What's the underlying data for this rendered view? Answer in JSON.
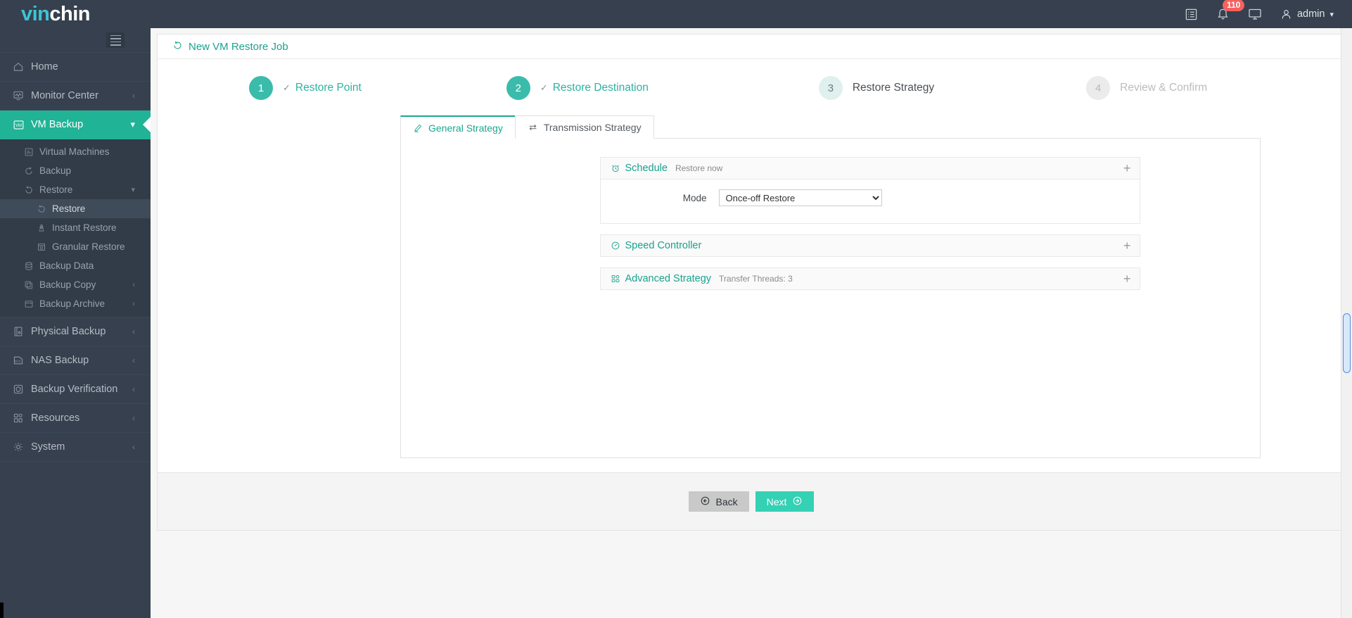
{
  "brand": {
    "part1": "vin",
    "part2": "chin"
  },
  "topbar": {
    "tasks_icon": "list-icon",
    "notifications_icon": "bell-icon",
    "notification_count": "110",
    "display_icon": "monitor-icon",
    "user_icon": "user-icon",
    "user_name": "admin",
    "user_chevron": "chevron-down-icon"
  },
  "sidebar": {
    "toggle": "hamburger-icon",
    "items": [
      {
        "label": "Home",
        "icon": "home-icon",
        "chevron": ""
      },
      {
        "label": "Monitor Center",
        "icon": "monitor-chart-icon",
        "chevron": "‹"
      },
      {
        "label": "VM Backup",
        "icon": "vm-icon",
        "chevron": "⌄",
        "active": true
      }
    ],
    "vm_backup_children": [
      {
        "label": "Virtual Machines",
        "icon": "grid-chart-icon",
        "chevron": ""
      },
      {
        "label": "Backup",
        "icon": "refresh-icon",
        "chevron": ""
      },
      {
        "label": "Restore",
        "icon": "restore-icon",
        "chevron": "⌄"
      }
    ],
    "restore_children": [
      {
        "label": "Restore",
        "icon": "restore-icon",
        "selected": true
      },
      {
        "label": "Instant Restore",
        "icon": "rocket-icon"
      },
      {
        "label": "Granular Restore",
        "icon": "archive-clock-icon"
      }
    ],
    "vm_backup_children_rest": [
      {
        "label": "Backup Data",
        "icon": "database-icon",
        "chevron": ""
      },
      {
        "label": "Backup Copy",
        "icon": "copy-icon",
        "chevron": "‹"
      },
      {
        "label": "Backup Archive",
        "icon": "box-icon",
        "chevron": "‹"
      }
    ],
    "items_bottom": [
      {
        "label": "Physical Backup",
        "icon": "server-icon",
        "chevron": "‹"
      },
      {
        "label": "NAS Backup",
        "icon": "nas-icon",
        "chevron": "‹"
      },
      {
        "label": "Backup Verification",
        "icon": "shield-check-icon",
        "chevron": "‹"
      },
      {
        "label": "Resources",
        "icon": "squares-icon",
        "chevron": "‹"
      },
      {
        "label": "System",
        "icon": "gear-icon",
        "chevron": "‹"
      }
    ]
  },
  "page": {
    "title": "New VM Restore Job",
    "title_icon": "restore-icon"
  },
  "steps": [
    {
      "num": "1",
      "label": "Restore Point",
      "state": "done",
      "check": "✓"
    },
    {
      "num": "2",
      "label": "Restore Destination",
      "state": "done",
      "check": "✓"
    },
    {
      "num": "3",
      "label": "Restore Strategy",
      "state": "current",
      "check": ""
    },
    {
      "num": "4",
      "label": "Review & Confirm",
      "state": "todo",
      "check": ""
    }
  ],
  "tabs": [
    {
      "label": "General Strategy",
      "icon": "pencil-icon",
      "active": true
    },
    {
      "label": "Transmission Strategy",
      "icon": "transfer-icon",
      "active": false
    }
  ],
  "sections": [
    {
      "title": "Schedule",
      "icon": "alarm-clock-icon",
      "summary": "Restore now",
      "expand": "+",
      "expanded": true,
      "field_label": "Mode",
      "field_value": "Once-off Restore",
      "field_options": [
        "Once-off Restore"
      ]
    },
    {
      "title": "Speed Controller",
      "icon": "gauge-icon",
      "summary": "",
      "expand": "+",
      "expanded": false
    },
    {
      "title": "Advanced Strategy",
      "icon": "grid-squares-icon",
      "summary": "Transfer Threads: 3",
      "expand": "+",
      "expanded": false
    }
  ],
  "footer": {
    "back_label": "Back",
    "back_icon": "arrow-left-circle-icon",
    "next_label": "Next",
    "next_icon": "arrow-right-circle-icon"
  },
  "colors": {
    "brand_teal": "#21b396",
    "accent_teal": "#34d1b4",
    "link_teal": "#18a38d",
    "sidebar_bg": "#36404e",
    "badge_red": "#f4615f"
  }
}
